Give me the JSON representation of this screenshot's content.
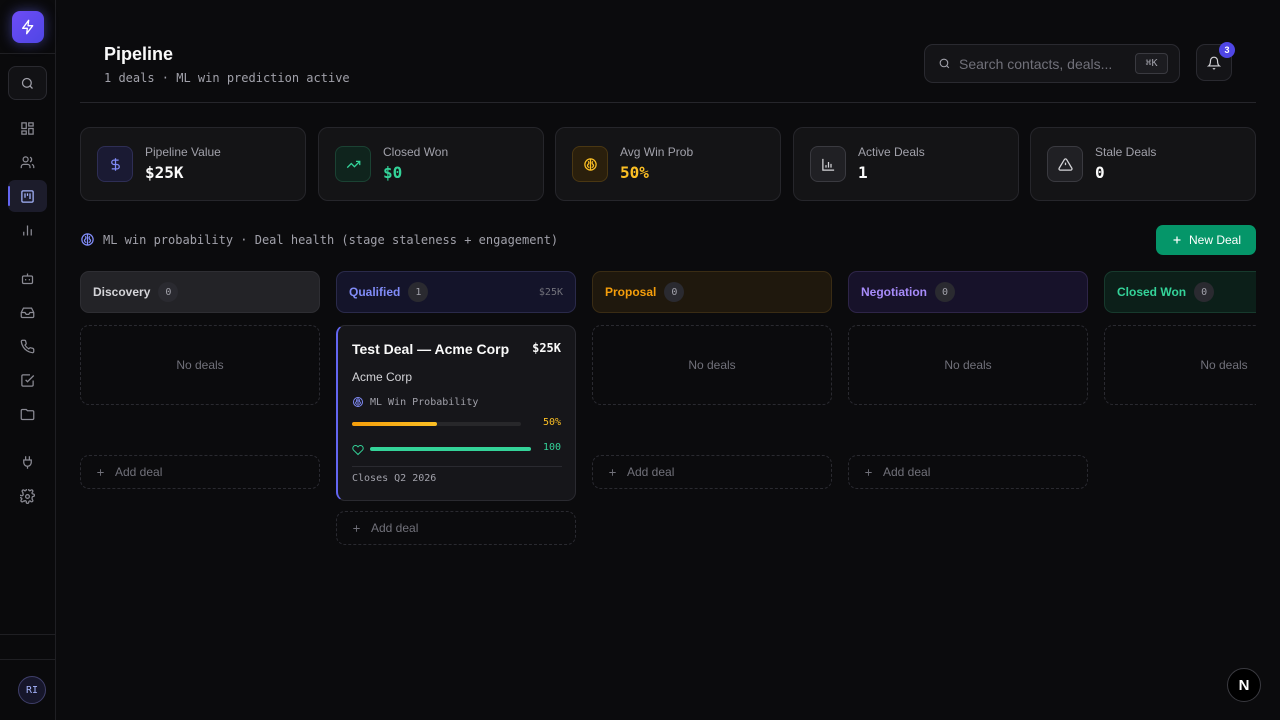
{
  "sidebar": {
    "items": [
      {
        "icon": "dashboard-icon"
      },
      {
        "icon": "users-icon"
      },
      {
        "icon": "kanban-icon",
        "active": true
      },
      {
        "icon": "chart-icon"
      },
      {
        "icon": "bot-icon"
      },
      {
        "icon": "inbox-icon"
      },
      {
        "icon": "phone-icon"
      },
      {
        "icon": "checkbox-icon"
      },
      {
        "icon": "folder-icon"
      },
      {
        "icon": "plug-icon"
      },
      {
        "icon": "settings-icon"
      }
    ],
    "avatar": "RI"
  },
  "header": {
    "title": "Pipeline",
    "subtitle": "1 deals · ML win prediction active",
    "search_placeholder": "Search contacts, deals...",
    "shortcut": "⌘K",
    "notifications": "3"
  },
  "stats": [
    {
      "label": "Pipeline Value",
      "value": "$25K",
      "color": "#fafafa",
      "icon": "dollar-icon"
    },
    {
      "label": "Closed Won",
      "value": "$0",
      "color": "#34d399",
      "icon": "trending-up-icon"
    },
    {
      "label": "Avg Win Prob",
      "value": "50%",
      "color": "#fbbf24",
      "icon": "brain-icon"
    },
    {
      "label": "Active Deals",
      "value": "1",
      "color": "#fafafa",
      "icon": "bar-chart-icon"
    },
    {
      "label": "Stale Deals",
      "value": "0",
      "color": "#fafafa",
      "icon": "warning-icon"
    }
  ],
  "ml_info": "ML win probability · Deal health (stage staleness + engagement)",
  "new_deal_label": "New Deal",
  "columns": [
    {
      "name": "Discovery",
      "count": "0",
      "total": "",
      "empty_label": "No deals",
      "add_label": "Add deal",
      "color": "#d4d4d8"
    },
    {
      "name": "Qualified",
      "count": "1",
      "total": "$25K",
      "empty_label": "",
      "add_label": "Add deal",
      "color": "#818cf8"
    },
    {
      "name": "Proposal",
      "count": "0",
      "total": "",
      "empty_label": "No deals",
      "add_label": "Add deal",
      "color": "#f59e0b"
    },
    {
      "name": "Negotiation",
      "count": "0",
      "total": "",
      "empty_label": "No deals",
      "add_label": "Add deal",
      "color": "#a78bfa"
    },
    {
      "name": "Closed Won",
      "count": "0",
      "total": "",
      "empty_label": "No deals",
      "add_label": "",
      "color": "#34d399"
    }
  ],
  "deal": {
    "title": "Test Deal — Acme Corp",
    "value": "$25K",
    "company": "Acme Corp",
    "ml_label": "ML Win Probability",
    "win_prob_label": "50%",
    "win_prob": 0.5,
    "health_label": "100",
    "health": 1.0,
    "closes": "Closes Q2 2026"
  }
}
